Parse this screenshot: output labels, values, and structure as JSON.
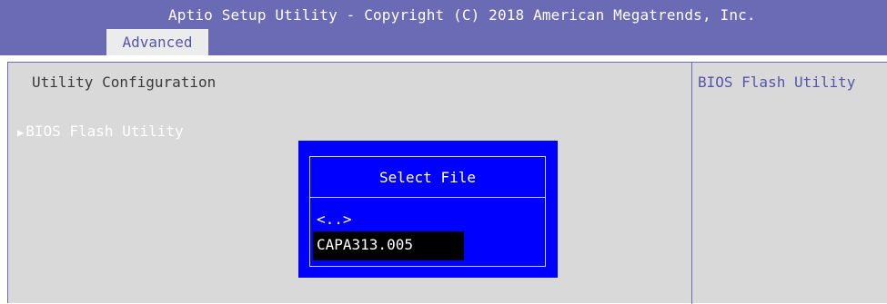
{
  "header": {
    "title": "Aptio Setup Utility - Copyright (C) 2018 American Megatrends, Inc.",
    "tabs": [
      {
        "label": "Advanced",
        "active": true
      }
    ]
  },
  "main": {
    "section_title": "Utility Configuration",
    "items": [
      {
        "label": "BIOS Flash Utility",
        "icon": "triangle-right-icon",
        "selected": true
      }
    ]
  },
  "help": {
    "text": "BIOS Flash Utility"
  },
  "dialog": {
    "title": "Select File",
    "files": [
      {
        "label": "<..>",
        "selected": false
      },
      {
        "label": "CAPA313.005",
        "selected": true
      }
    ]
  },
  "colors": {
    "header_bg": "#6a6ab5",
    "panel_bg": "#d9d9d9",
    "dialog_bg": "#0000ff",
    "selection_bg": "#000000",
    "help_text": "#5555aa"
  }
}
